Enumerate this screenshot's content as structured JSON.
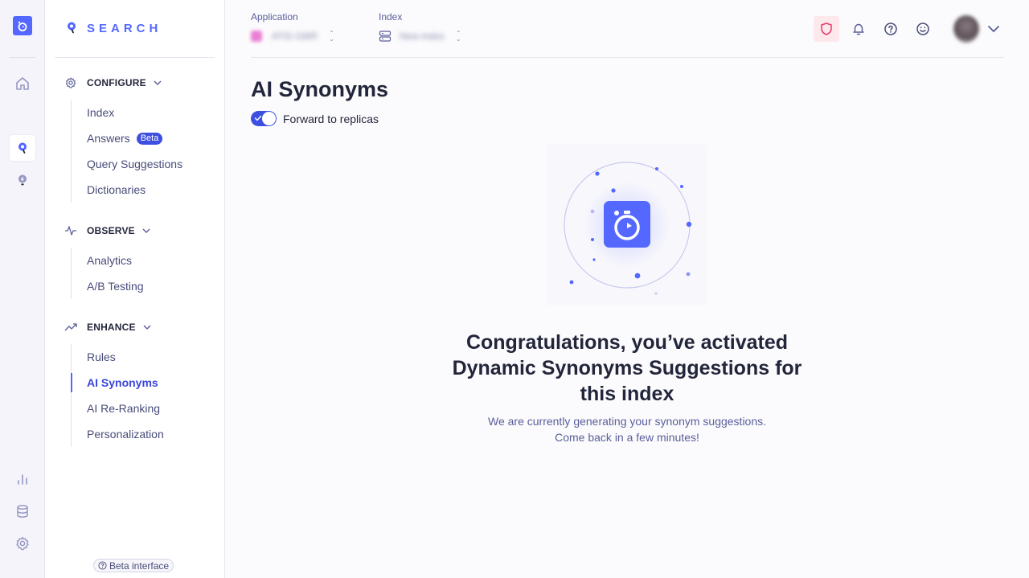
{
  "rail": {
    "items": [
      {
        "name": "app-logo",
        "icon": "stopwatch-icon"
      },
      {
        "name": "home",
        "icon": "home-icon"
      },
      {
        "name": "search",
        "icon": "search-product-icon",
        "active": true
      },
      {
        "name": "recommend",
        "icon": "bulb-icon"
      },
      {
        "name": "analytics",
        "icon": "bar-chart-icon"
      },
      {
        "name": "data-sources",
        "icon": "database-icon"
      },
      {
        "name": "settings",
        "icon": "gear-icon"
      }
    ]
  },
  "nav": {
    "brand": "SEARCH",
    "sections": [
      {
        "label": "CONFIGURE",
        "icon": "gear-icon",
        "items": [
          {
            "label": "Index"
          },
          {
            "label": "Answers",
            "badge": "Beta"
          },
          {
            "label": "Query Suggestions"
          },
          {
            "label": "Dictionaries"
          }
        ]
      },
      {
        "label": "OBSERVE",
        "icon": "pulse-icon",
        "items": [
          {
            "label": "Analytics"
          },
          {
            "label": "A/B Testing"
          }
        ]
      },
      {
        "label": "ENHANCE",
        "icon": "trend-up-icon",
        "items": [
          {
            "label": "Rules"
          },
          {
            "label": "AI Synonyms",
            "active": true
          },
          {
            "label": "AI Re-Ranking"
          },
          {
            "label": "Personalization"
          }
        ]
      }
    ],
    "beta_interface": "Beta interface"
  },
  "topbar": {
    "application_label": "Application",
    "application_value": "ATIS G8IR",
    "index_label": "Index",
    "index_value": "New index",
    "icons": [
      "shield-icon",
      "bell-icon",
      "help-icon",
      "smiley-icon"
    ]
  },
  "main": {
    "title": "AI Synonyms",
    "toggle": {
      "label": "Forward to replicas",
      "checked": true
    },
    "headline": "Congratulations, you’ve activated Dynamic Synonyms Suggestions for this index",
    "subtext_line1": "We are currently generating your synonym suggestions.",
    "subtext_line2": "Come back in a few minutes!"
  },
  "colors": {
    "accent": "#5468ff",
    "accent_dark": "#3c4fe0",
    "text": "#23263b",
    "muted": "#5a5e9a"
  }
}
